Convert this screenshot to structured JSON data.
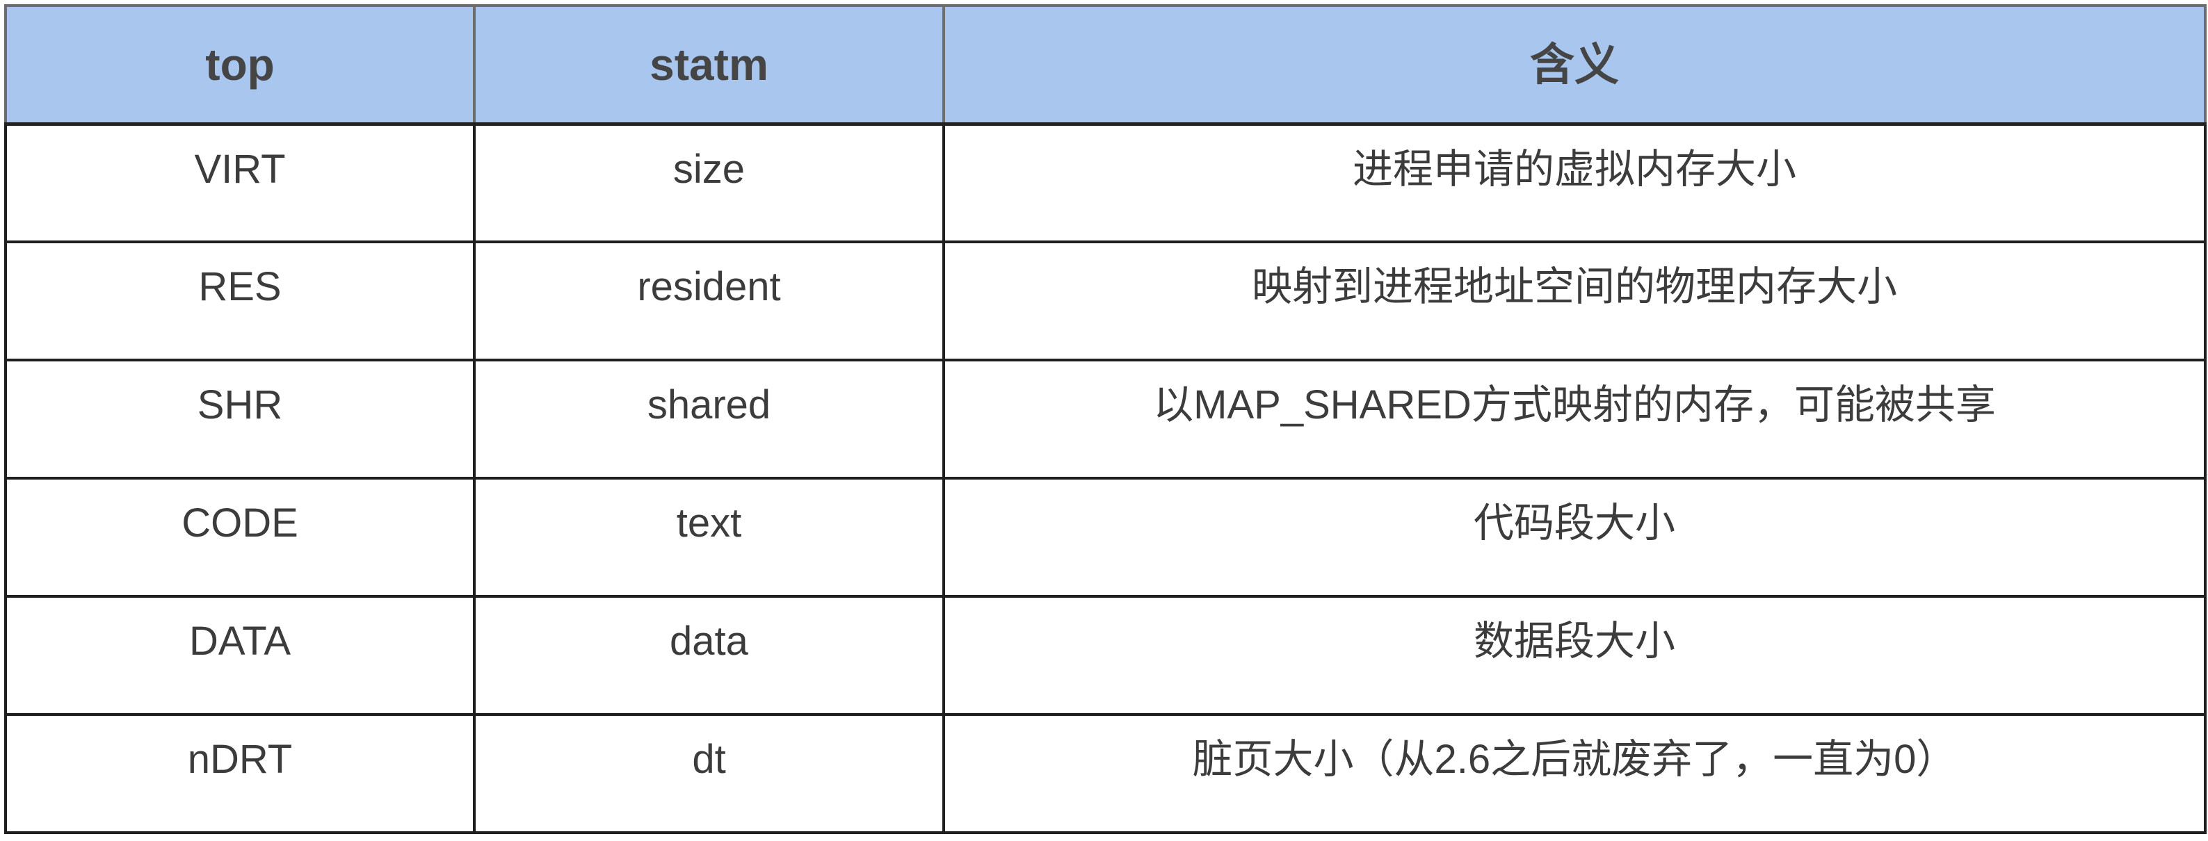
{
  "table": {
    "headers": [
      "top",
      "statm",
      "含义"
    ],
    "rows": [
      [
        "VIRT",
        "size",
        "进程申请的虚拟内存大小"
      ],
      [
        "RES",
        "resident",
        "映射到进程地址空间的物理内存大小"
      ],
      [
        "SHR",
        "shared",
        "以MAP_SHARED方式映射的内存，可能被共享"
      ],
      [
        "CODE",
        "text",
        "代码段大小"
      ],
      [
        "DATA",
        "data",
        "数据段大小"
      ],
      [
        "nDRT",
        "dt",
        "脏页大小（从2.6之后就废弃了，一直为0）"
      ]
    ]
  },
  "colors": {
    "header_background": "#a8c6ee",
    "header_text": "#454545",
    "cell_text": "#3c3c3c",
    "border": "#1f1f1f"
  }
}
